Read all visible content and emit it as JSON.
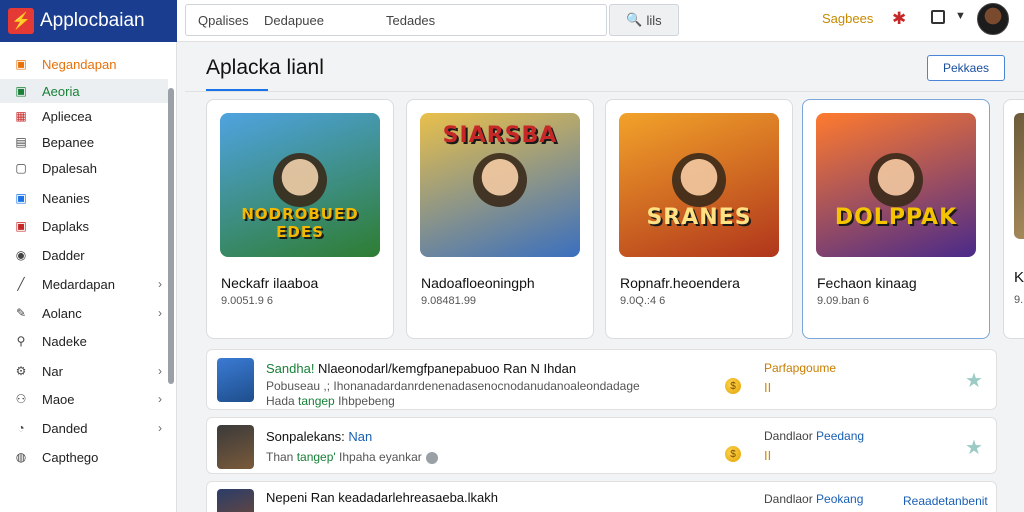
{
  "app": {
    "title": "Applocbaian"
  },
  "search": {
    "seg1": "Qpalises",
    "seg2": "Dedapuee",
    "seg3": "Tedades",
    "button_label": "lils"
  },
  "header": {
    "settings_link": "Sagbees"
  },
  "sidebar": {
    "items": [
      {
        "label": "Negandapan",
        "icon": "home-icon",
        "color": "#e8710a"
      },
      {
        "label": "Aeoria",
        "icon": "apps-icon",
        "color": "#188038"
      },
      {
        "label": "Apliecea",
        "icon": "grid-icon",
        "color": "#c62828"
      },
      {
        "label": "Bepanee",
        "icon": "list-icon",
        "color": "#444"
      },
      {
        "label": "Dpalesah",
        "icon": "book-icon",
        "color": "#444"
      },
      {
        "label": "Neanies",
        "icon": "film-icon",
        "color": "#1a73e8"
      },
      {
        "label": "Daplaks",
        "icon": "tag-icon",
        "color": "#c62828"
      },
      {
        "label": "Dadder",
        "icon": "device-icon",
        "color": "#444"
      },
      {
        "label": "Medardapan",
        "icon": "pen-icon",
        "color": "#444"
      },
      {
        "label": "Aolanc",
        "icon": "pencil-icon",
        "color": "#444"
      },
      {
        "label": "Nadeke",
        "icon": "search-icon",
        "color": "#444"
      },
      {
        "label": "Nar",
        "icon": "settings-icon",
        "color": "#444"
      },
      {
        "label": "Maoe",
        "icon": "people-icon",
        "color": "#444"
      },
      {
        "label": "Danded",
        "icon": "clock-icon",
        "color": "#444"
      },
      {
        "label": "Capthego",
        "icon": "help-icon",
        "color": "#444"
      }
    ]
  },
  "main": {
    "title": "Aplacka lianl",
    "action_button": "Pekkaes",
    "cards": [
      {
        "name": "Neckafr ilaaboa",
        "meta": "9.0051.9 6",
        "art_text": "NODROBUED EDES",
        "bg1": "#4fa3e0",
        "bg2": "#2e7d32",
        "txt": "#f5b800"
      },
      {
        "name": "Nadoafloeoningph",
        "meta": "9.08481.99",
        "art_text": "SIARSBA",
        "bg1": "#e9c04a",
        "bg2": "#3a6fbf",
        "txt": "#c62828"
      },
      {
        "name": "Ropnafr.heoendera",
        "meta": "9.0Q.:4 6",
        "art_text": "SRANES",
        "bg1": "#f2a22a",
        "bg2": "#b0361c",
        "txt": "#ffe082"
      },
      {
        "name": "Fechaon kinaag",
        "meta": "9.09.ban 6",
        "art_text": "DOLPPAK",
        "bg1": "#ff7b2e",
        "bg2": "#4a2a8a",
        "txt": "#f5c400"
      }
    ],
    "edge_card": {
      "letter": "K",
      "meta": "9."
    },
    "rows": [
      {
        "title_green": "Sandha!",
        "title_rest": " Nlaeonodarl/kemgfpanepabuoo Ran N Ihdan",
        "sub_rest": "Pobuseau ,; Ihonanadardanrdenenadasenocnodanudanoaleondadage",
        "sub2_a": "Hada",
        "sub2_green": "tangep",
        "sub2_b": " Ihbpebeng",
        "badge": "II",
        "right_orange": "Parfapgoume",
        "right_a": "",
        "right_blue": ""
      },
      {
        "title_green": "",
        "title_rest": "Sonpalekans:",
        "title_blue": " Nan",
        "sub_rest": "Than",
        "sub2_green": " tangep'",
        "sub2_b": " Ihpaha eyankar",
        "badge": "II",
        "right_a": "Dandlaor ",
        "right_blue": "Peedang"
      },
      {
        "title_green": "",
        "title_rest": "Nepeni Ran keadadarlehreasaeba.lkakh",
        "sub_rest": "",
        "right_a": "Dandlaor ",
        "right_blue": "Peokang",
        "far_right": "Reaadetanbenit"
      }
    ]
  }
}
